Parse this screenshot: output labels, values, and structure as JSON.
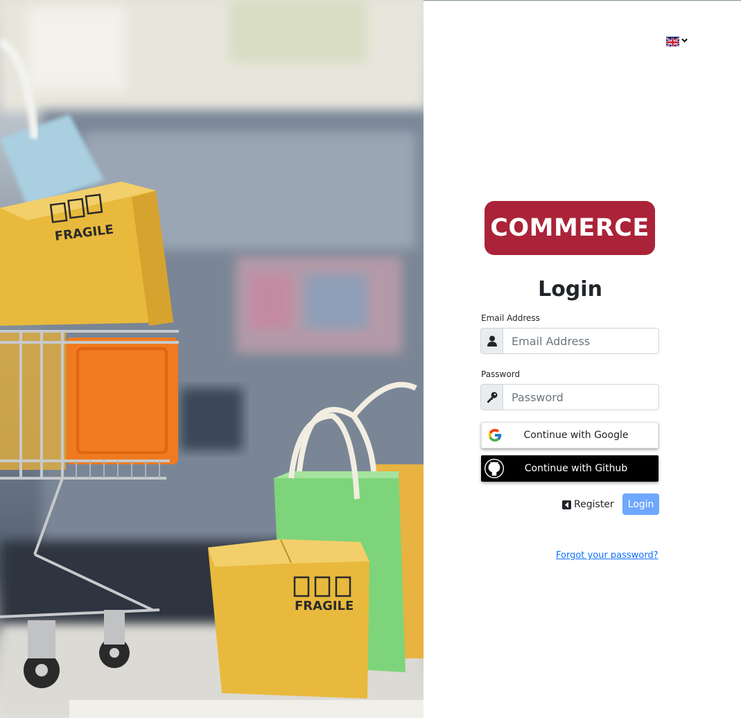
{
  "language": {
    "selected_flag": "uk-flag-icon"
  },
  "brand": {
    "logo_text": "COMMERCE",
    "logo_color": "#ab2338"
  },
  "form": {
    "title": "Login",
    "email": {
      "label": "Email Address",
      "placeholder": "Email Address",
      "value": ""
    },
    "password": {
      "label": "Password",
      "placeholder": "Password",
      "value": ""
    }
  },
  "social": {
    "google_label": "Continue with Google",
    "github_label": "Continue with Github"
  },
  "actions": {
    "register_label": "Register",
    "login_label": "Login",
    "forgot_label": "Forgot your password?"
  },
  "hero": {
    "box_label": "FRAGILE"
  },
  "colors": {
    "login_button": "#6ea8fe",
    "link": "#0d6efd",
    "github_bg": "#000000"
  }
}
